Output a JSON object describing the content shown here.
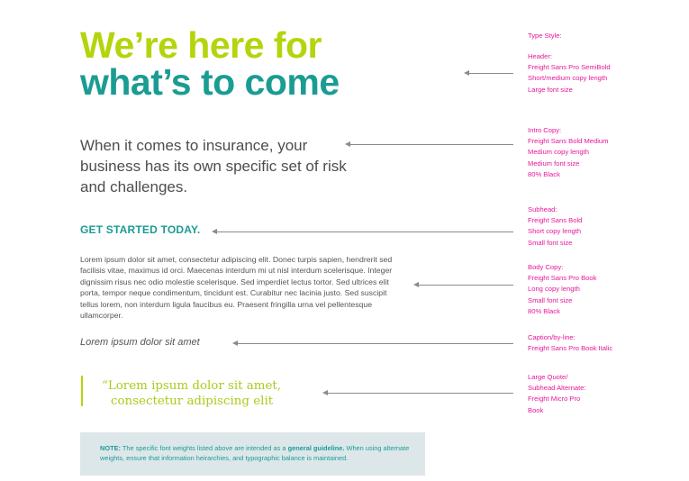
{
  "header": {
    "line1": "We’re here for",
    "line2": "what’s to come"
  },
  "intro": {
    "text": "When it comes to insurance, your business has its own specific set of risk and challenges."
  },
  "subhead": {
    "text": "GET STARTED TODAY."
  },
  "body_copy": {
    "text": "Lorem ipsum dolor sit amet, consectetur adipiscing elit. Donec turpis sapien, hendrerit sed facilisis vitae, maximus id orci. Maecenas interdum mi ut nisl interdum scelerisque. Integer dignissim risus nec odio molestie scelerisque. Sed imperdiet lectus tortor. Sed ultrices elit porta, tempor neque condimentum, tincidunt est. Curabitur nec lacinia justo. Sed suscipit tellus lorem, non interdum ligula faucibus eu. Praesent fringilla urna vel pellentesque ullamcorper."
  },
  "caption": {
    "text": "Lorem ipsum dolor sit amet"
  },
  "quote": {
    "line1": "“Lorem ipsum dolor sit amet,",
    "line2": "consectetur adipiscing elit"
  },
  "note": {
    "label": "NOTE:",
    "text_before": " The specific font weights listed above are intended as a ",
    "emphasis": "general guideline.",
    "text_after": " When using alternate weights, ensure that information heirarchies, and typographic balance is maintained."
  },
  "annotations": {
    "title": "Type Style:",
    "header": [
      "Header:",
      "Freight Sans Pro SemiBold",
      "Short/medium copy length",
      "Large font size"
    ],
    "intro": [
      "Intro Copy:",
      "Freight Sans Bold Medium",
      "Medium copy length",
      "Medium font size",
      "80% Black"
    ],
    "subhead": [
      "Subhead:",
      "Freight Sans Bold",
      "Short copy length",
      "Small font size"
    ],
    "body": [
      "Body Copy:",
      "Freight Sans Pro Book",
      "Long copy length",
      "Small font size",
      "80% Black"
    ],
    "caption": [
      "Caption/by-line:",
      "Freight Sans Pro Book Italic"
    ],
    "quote": [
      "Large Quote/",
      "Subhead Alternate:",
      "Freight Micro Pro",
      "Book"
    ]
  },
  "colors": {
    "lime": "#b5d40c",
    "teal": "#1b9c93",
    "annotation_magenta": "#e5189a",
    "note_background": "#dde7ea"
  }
}
